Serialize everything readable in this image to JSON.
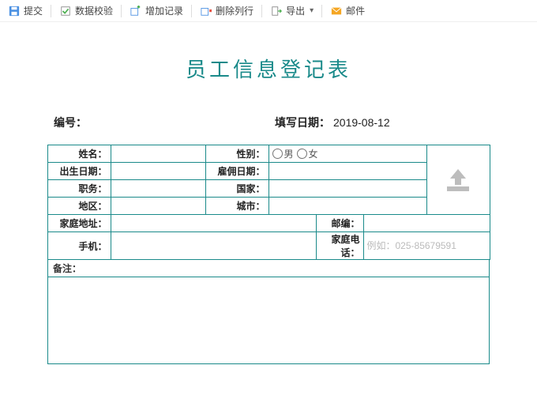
{
  "toolbar": {
    "submit": "提交",
    "validate": "数据校验",
    "add": "增加记录",
    "delete": "删除列行",
    "export": "导出",
    "mail": "邮件"
  },
  "title": "员工信息登记表",
  "meta": {
    "id_label": "编号：",
    "date_label": "填写日期：",
    "date_value": "2019-08-12"
  },
  "labels": {
    "name": "姓名：",
    "gender": "性别：",
    "birth": "出生日期：",
    "hire": "雇佣日期：",
    "position": "职务：",
    "country": "国家：",
    "region": "地区：",
    "city": "城市：",
    "address": "家庭地址：",
    "zip": "邮编：",
    "mobile": "手机：",
    "home_phone": "家庭电话：",
    "remark": "备注："
  },
  "gender": {
    "male": "男",
    "female": "女"
  },
  "placeholders": {
    "home_phone": "例如：025-85679591"
  },
  "colors": {
    "accent": "#1a8a8a"
  }
}
